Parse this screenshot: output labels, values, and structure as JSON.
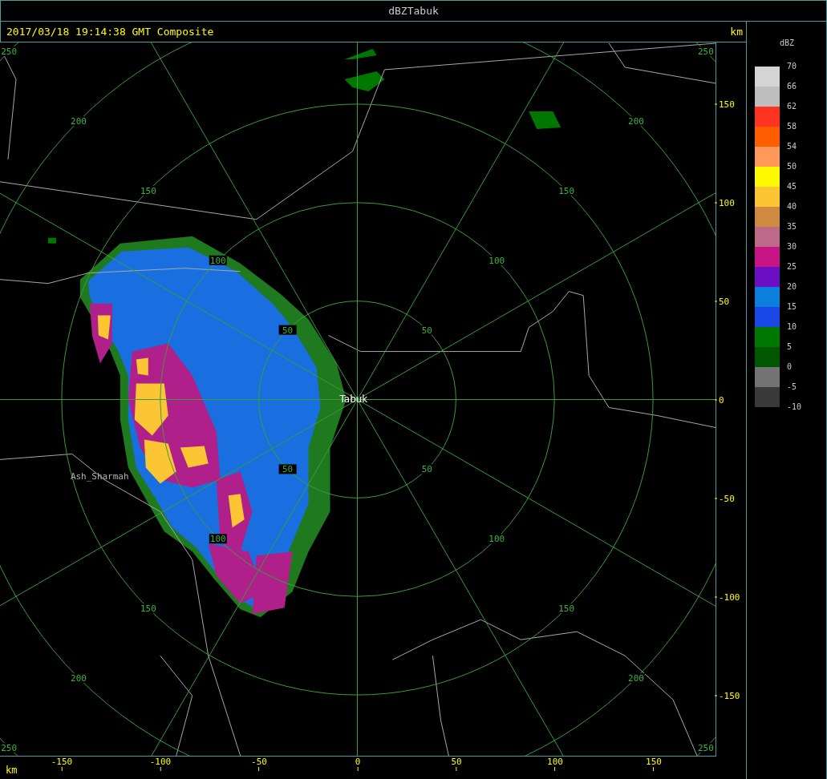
{
  "window": {
    "title": "dBZTabuk"
  },
  "header": {
    "timestamp": "2017/03/18 19:14:38 GMT Composite",
    "unit": "km"
  },
  "radar": {
    "range_rings": [
      {
        "labels": [
          "50",
          "50",
          "50",
          "50"
        ]
      },
      {
        "labels": [
          "100",
          "100",
          "100",
          "100"
        ]
      },
      {
        "labels": [
          "150",
          "150",
          "150",
          "150"
        ]
      },
      {
        "labels": [
          "200",
          "200",
          "200",
          "200"
        ]
      },
      {
        "labels": [
          "250",
          "250",
          "250",
          "250"
        ]
      }
    ],
    "places": [
      {
        "name": "Tabuk",
        "kind": "station"
      },
      {
        "name": "Ash_Sharmah",
        "kind": "town"
      }
    ]
  },
  "right_axis": {
    "ticks": [
      "150",
      "100",
      "50",
      "0",
      "-50",
      "-100",
      "-150"
    ]
  },
  "bottom_axis": {
    "unit": "km",
    "ticks": [
      "-150",
      "-100",
      "-50",
      "0",
      "50",
      "100",
      "150"
    ]
  },
  "legend": {
    "title": "dBZ",
    "bands": [
      {
        "label": "70",
        "color": "#d4d4d4"
      },
      {
        "label": "66",
        "color": "#bebebe"
      },
      {
        "label": "62",
        "color": "#fe3421"
      },
      {
        "label": "58",
        "color": "#fe5d00"
      },
      {
        "label": "54",
        "color": "#fe995a"
      },
      {
        "label": "50",
        "color": "#fefb00"
      },
      {
        "label": "45",
        "color": "#fbc534"
      },
      {
        "label": "40",
        "color": "#cf8a40"
      },
      {
        "label": "35",
        "color": "#bc6a88"
      },
      {
        "label": "30",
        "color": "#c71585"
      },
      {
        "label": "25",
        "color": "#6a0fc3"
      },
      {
        "label": "20",
        "color": "#0a7fdb"
      },
      {
        "label": "15",
        "color": "#1a48e6"
      },
      {
        "label": "10",
        "color": "#007800"
      },
      {
        "label": "5",
        "color": "#005700"
      },
      {
        "label": "0",
        "color": "#737373"
      },
      {
        "label": "-5",
        "color": "#393939"
      }
    ],
    "bottom_label": "-10"
  }
}
